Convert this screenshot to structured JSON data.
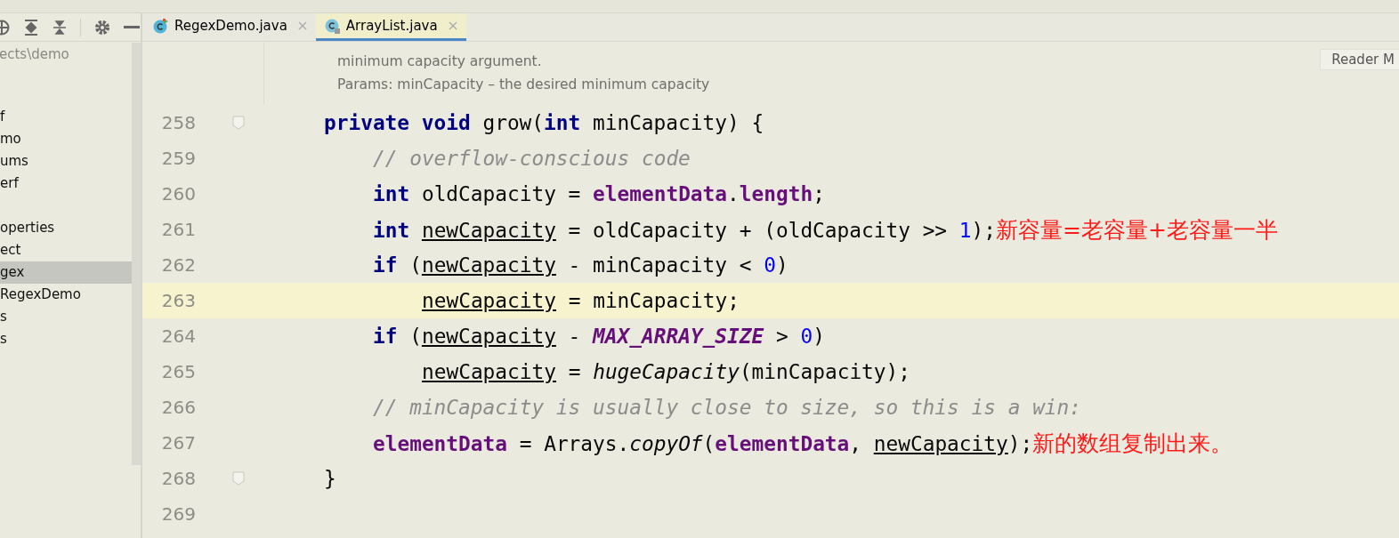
{
  "sidebar": {
    "path": "ects\\demo",
    "items": [
      {
        "label": "f",
        "selected": false
      },
      {
        "label": "mo",
        "selected": false
      },
      {
        "label": "ums",
        "selected": false
      },
      {
        "label": "erf",
        "selected": false
      },
      {
        "kind": "blank",
        "selected": false
      },
      {
        "label": "operties",
        "selected": false
      },
      {
        "label": "ect",
        "selected": false
      },
      {
        "label": "gex",
        "selected": true
      },
      {
        "label": "RegexDemo",
        "selected": false
      },
      {
        "label": "s",
        "selected": false
      },
      {
        "label": "s",
        "selected": false
      }
    ]
  },
  "tabs": [
    {
      "label": "RegexDemo.java",
      "selected": false,
      "kind": "runnable"
    },
    {
      "label": "ArrayList.java",
      "selected": true,
      "kind": "locked"
    }
  ],
  "doc": {
    "lines": [
      "minimum capacity argument.",
      "Params: minCapacity – the desired minimum capacity"
    ],
    "reader_button": "Reader M"
  },
  "code": [
    {
      "number": "258",
      "fold": true,
      "current": false,
      "kind": "outer",
      "tokens": [
        {
          "kind": "kw",
          "text": "private void"
        },
        {
          "kind": "plain",
          "text": " grow("
        },
        {
          "kind": "kw",
          "text": "int"
        },
        {
          "kind": "plain",
          "text": " minCapacity) {"
        }
      ]
    },
    {
      "number": "259",
      "fold": false,
      "current": false,
      "kind": "body",
      "tokens": [
        {
          "kind": "comment",
          "text": "// overflow-conscious code"
        }
      ]
    },
    {
      "number": "260",
      "fold": false,
      "current": false,
      "kind": "body",
      "tokens": [
        {
          "kind": "kw",
          "text": "int"
        },
        {
          "kind": "plain",
          "text": " oldCapacity = "
        },
        {
          "kind": "field",
          "text": "elementData"
        },
        {
          "kind": "plain",
          "text": "."
        },
        {
          "kind": "field",
          "text": "length"
        },
        {
          "kind": "plain",
          "text": ";"
        }
      ]
    },
    {
      "number": "261",
      "fold": false,
      "current": false,
      "kind": "body",
      "tokens": [
        {
          "kind": "kw",
          "text": "int "
        },
        {
          "kind": "var",
          "text": "newCapacity"
        },
        {
          "kind": "plain",
          "text": " = oldCapacity + (oldCapacity >> "
        },
        {
          "kind": "num",
          "text": "1"
        },
        {
          "kind": "plain",
          "text": ");"
        },
        {
          "kind": "note",
          "text": "新容量=老容量+老容量一半"
        }
      ]
    },
    {
      "number": "262",
      "fold": false,
      "current": false,
      "kind": "body",
      "tokens": [
        {
          "kind": "kw",
          "text": "if"
        },
        {
          "kind": "plain",
          "text": " ("
        },
        {
          "kind": "var",
          "text": "newCapacity"
        },
        {
          "kind": "plain",
          "text": " - minCapacity < "
        },
        {
          "kind": "num",
          "text": "0"
        },
        {
          "kind": "plain",
          "text": ")"
        }
      ]
    },
    {
      "number": "263",
      "fold": false,
      "current": true,
      "kind": "nested",
      "tokens": [
        {
          "kind": "var",
          "text": "newCapacity"
        },
        {
          "kind": "plain",
          "text": " = minCapacity;"
        }
      ]
    },
    {
      "number": "264",
      "fold": false,
      "current": false,
      "kind": "body",
      "tokens": [
        {
          "kind": "kw",
          "text": "if"
        },
        {
          "kind": "plain",
          "text": " ("
        },
        {
          "kind": "var",
          "text": "newCapacity"
        },
        {
          "kind": "plain",
          "text": " - "
        },
        {
          "kind": "const",
          "text": "MAX_ARRAY_SIZE"
        },
        {
          "kind": "plain",
          "text": " > "
        },
        {
          "kind": "num",
          "text": "0"
        },
        {
          "kind": "plain",
          "text": ")"
        }
      ]
    },
    {
      "number": "265",
      "fold": false,
      "current": false,
      "kind": "nested",
      "tokens": [
        {
          "kind": "var",
          "text": "newCapacity"
        },
        {
          "kind": "plain",
          "text": " = "
        },
        {
          "kind": "call",
          "text": "hugeCapacity"
        },
        {
          "kind": "plain",
          "text": "(minCapacity);"
        }
      ]
    },
    {
      "number": "266",
      "fold": false,
      "current": false,
      "kind": "body",
      "tokens": [
        {
          "kind": "comment",
          "text": "// minCapacity is usually close to size, so this is a win:"
        }
      ]
    },
    {
      "number": "267",
      "fold": false,
      "current": false,
      "kind": "body",
      "tokens": [
        {
          "kind": "field",
          "text": "elementData"
        },
        {
          "kind": "plain",
          "text": " = Arrays."
        },
        {
          "kind": "call",
          "text": "copyOf"
        },
        {
          "kind": "plain",
          "text": "("
        },
        {
          "kind": "field",
          "text": "elementData"
        },
        {
          "kind": "plain",
          "text": ", "
        },
        {
          "kind": "var",
          "text": "newCapacity"
        },
        {
          "kind": "plain",
          "text": ");"
        },
        {
          "kind": "note",
          "text": "新的数组复制出来。"
        }
      ]
    },
    {
      "number": "268",
      "fold": true,
      "current": false,
      "kind": "outer",
      "tokens": [
        {
          "kind": "plain",
          "text": "}"
        }
      ]
    },
    {
      "number": "269",
      "fold": false,
      "current": false,
      "kind": "outer"
    }
  ]
}
